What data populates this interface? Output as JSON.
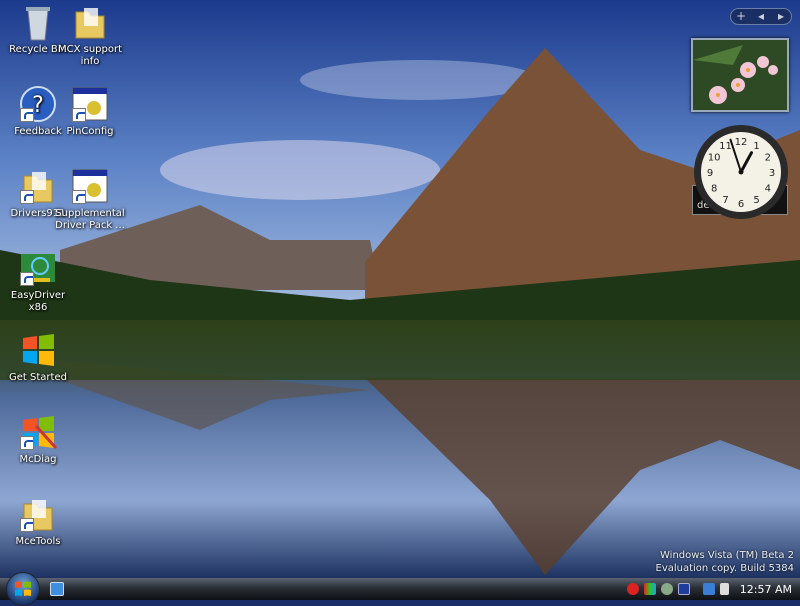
{
  "desktop_icons": [
    {
      "label": "Recycle Bin",
      "icon": "recycle-bin-icon"
    },
    {
      "label": "MCX support info",
      "icon": "folder-icon"
    },
    {
      "label": "Feedback",
      "icon": "help-icon"
    },
    {
      "label": "PinConfig",
      "icon": "application-icon"
    },
    {
      "label": "Drivers911",
      "icon": "folder-icon"
    },
    {
      "label": "Supplemental Driver Pack ...",
      "icon": "application-icon"
    },
    {
      "label": "EasyDriver x86",
      "icon": "circuit-board-icon"
    },
    {
      "label": "Get Started",
      "icon": "windows-logo-icon"
    },
    {
      "label": "McDiag",
      "icon": "diagnostic-icon"
    },
    {
      "label": "MceTools",
      "icon": "folder-icon"
    }
  ],
  "sidebar": {
    "add_label": "+",
    "prev_label": "◂",
    "next_label": "▸",
    "gadget_fragment": "de"
  },
  "clock": {
    "hour": 12,
    "minute": 57
  },
  "watermark": {
    "line1": "Windows Vista (TM) Beta 2",
    "line2": "Evaluation copy. Build 5384"
  },
  "taskbar": {
    "time": "12:57 AM"
  }
}
